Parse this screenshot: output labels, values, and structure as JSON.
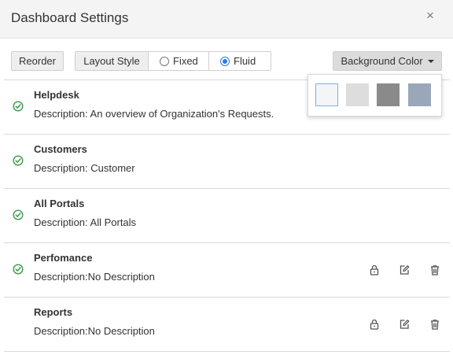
{
  "dialog": {
    "title": "Dashboard Settings",
    "close_glyph": "×"
  },
  "toolbar": {
    "reorder_label": "Reorder",
    "layout_style_label": "Layout Style",
    "layout_options": [
      {
        "label": "Fixed",
        "selected": false
      },
      {
        "label": "Fluid",
        "selected": true
      }
    ],
    "background_color_label": "Background Color"
  },
  "background_swatches": [
    {
      "color": "#f4f5f7",
      "selected": true
    },
    {
      "color": "#dddddd",
      "selected": false
    },
    {
      "color": "#8a8a8a",
      "selected": false
    },
    {
      "color": "#9aa7ba",
      "selected": false
    }
  ],
  "dashboards": [
    {
      "name": "Helpdesk",
      "description": "Description: An overview of Organization's Requests.",
      "enabled": true,
      "actions": false
    },
    {
      "name": "Customers",
      "description": "Description: Customer",
      "enabled": true,
      "actions": false
    },
    {
      "name": "All Portals",
      "description": "Description: All Portals",
      "enabled": true,
      "actions": false
    },
    {
      "name": "Perfomance",
      "description": "Description:No Description",
      "enabled": true,
      "actions": true
    },
    {
      "name": "Reports",
      "description": "Description:No Description",
      "enabled": false,
      "actions": true
    }
  ],
  "colors": {
    "check_green": "#3a9a4a",
    "icon_gray": "#555555",
    "radio_blue": "#2a7ae2"
  },
  "icons": {
    "enabled": "check-circle-icon",
    "lock": "lock-icon",
    "edit": "edit-icon",
    "delete": "trash-icon"
  }
}
